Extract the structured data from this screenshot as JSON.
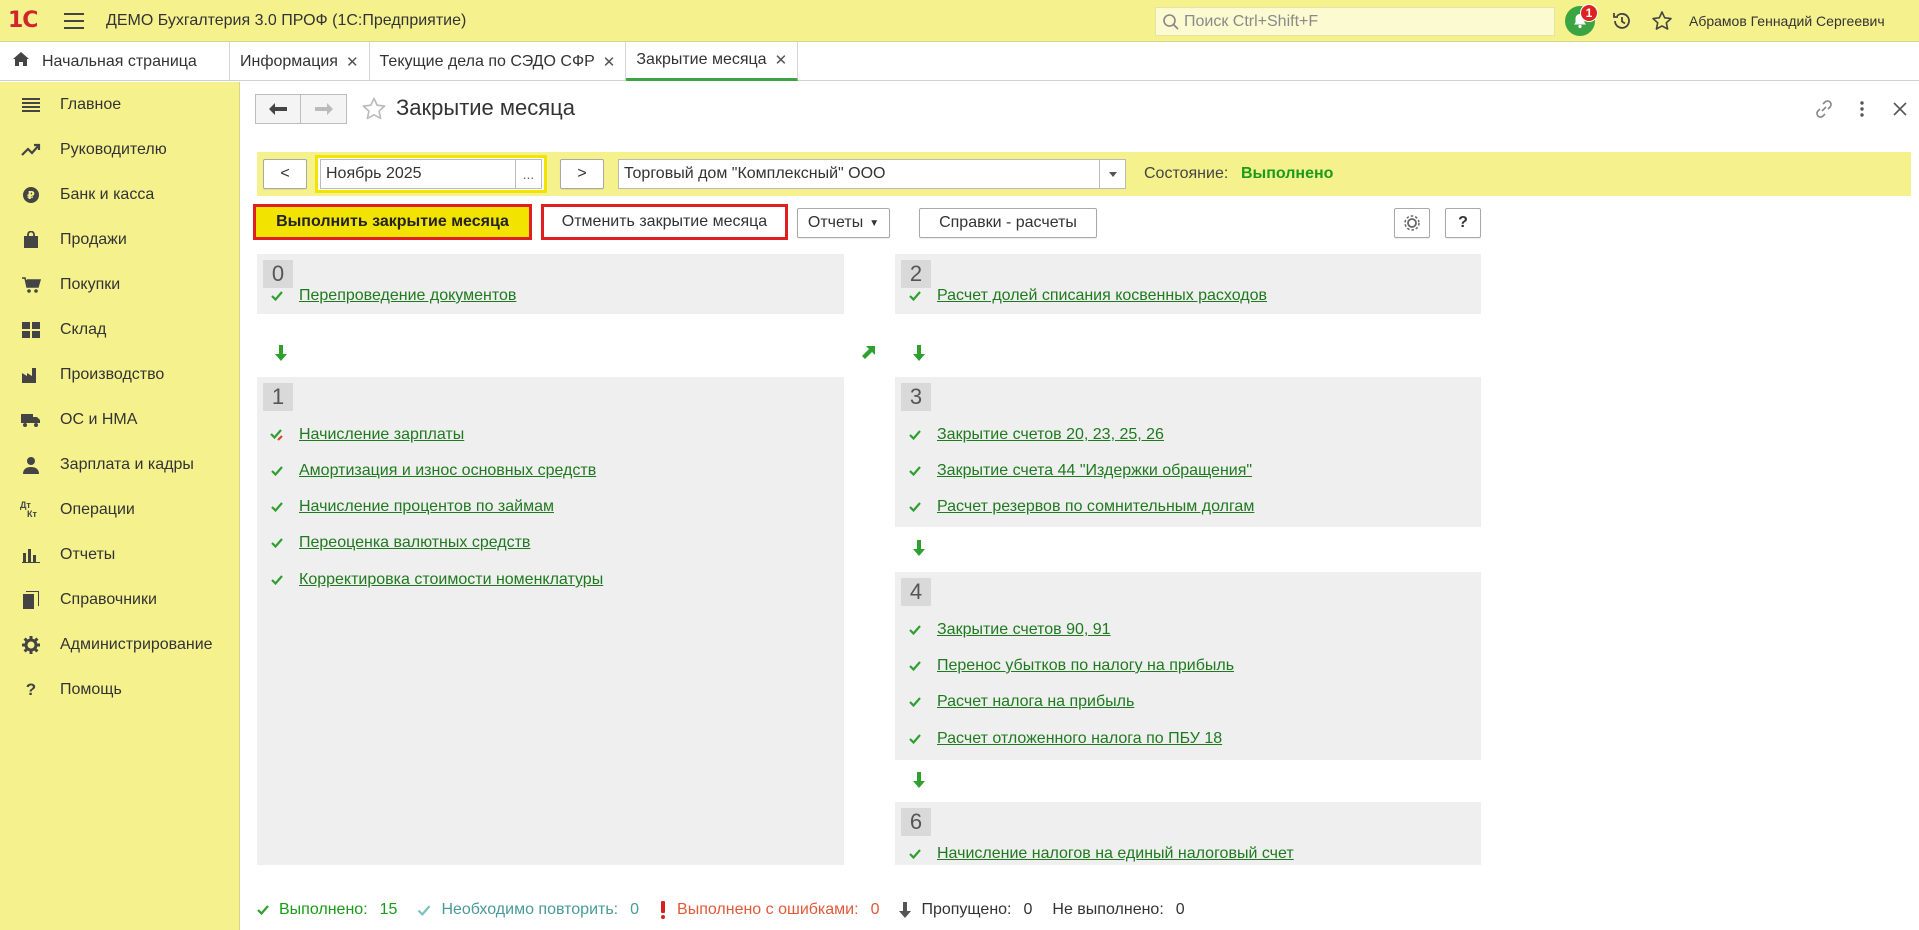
{
  "app": {
    "logo_text": "1С",
    "title": "ДЕМО Бухгалтерия 3.0 ПРОФ  (1С:Предприятие)",
    "search_placeholder": "Поиск Ctrl+Shift+F",
    "notifications_count": "1",
    "user_name": "Абрамов Геннадий Сергеевич",
    "accent_color": "#f5f28e",
    "green": "#1a9b1a"
  },
  "tabs": [
    {
      "label": "Начальная страница",
      "icon": "home-icon"
    },
    {
      "label": "Информация",
      "closable": true
    },
    {
      "label": "Текущие дела по СЭДО СФР",
      "closable": true
    },
    {
      "label": "Закрытие месяца",
      "closable": true,
      "active": true
    }
  ],
  "sidebar": {
    "items": [
      {
        "label": "Главное",
        "icon": "menu-lines-icon"
      },
      {
        "label": "Руководителю",
        "icon": "trend-icon"
      },
      {
        "label": "Банк и касса",
        "icon": "ruble-coin-icon"
      },
      {
        "label": "Продажи",
        "icon": "shopping-bag-icon"
      },
      {
        "label": "Покупки",
        "icon": "cart-icon"
      },
      {
        "label": "Склад",
        "icon": "warehouse-icon"
      },
      {
        "label": "Производство",
        "icon": "factory-icon"
      },
      {
        "label": "ОС и НМА",
        "icon": "truck-icon"
      },
      {
        "label": "Зарплата и кадры",
        "icon": "person-icon"
      },
      {
        "label": "Операции",
        "icon": "dt-kt-icon"
      },
      {
        "label": "Отчеты",
        "icon": "bar-chart-icon"
      },
      {
        "label": "Справочники",
        "icon": "books-icon"
      },
      {
        "label": "Администрирование",
        "icon": "gear-icon"
      },
      {
        "label": "Помощь",
        "icon": "question-icon"
      }
    ],
    "dt_kt": [
      "Дт",
      "Кт"
    ]
  },
  "form": {
    "title": "Закрытие месяца",
    "prev_label": "<",
    "next_label": ">",
    "period_value": "Ноябрь 2025",
    "period_dots": "...",
    "organization": "Торговый дом \"Комплексный\" ООО",
    "state_label": "Состояние:",
    "state_value": "Выполнено",
    "run_button": "Выполнить закрытие месяца",
    "cancel_button": "Отменить закрытие месяца",
    "reports_button": "Отчеты",
    "spravki_button": "Справки - расчеты",
    "help_button": "?"
  },
  "steps": {
    "s0": {
      "num": "0",
      "tasks": [
        "Перепроведение документов"
      ]
    },
    "s1": {
      "num": "1",
      "tasks": [
        "Начисление зарплаты",
        "Амортизация и износ основных средств",
        "Начисление процентов по займам",
        "Переоценка валютных средств",
        "Корректировка стоимости номенклатуры"
      ]
    },
    "s2": {
      "num": "2",
      "tasks": [
        "Расчет долей списания косвенных расходов"
      ]
    },
    "s3": {
      "num": "3",
      "tasks": [
        "Закрытие счетов 20, 23, 25, 26",
        "Закрытие счета 44 \"Издержки обращения\"",
        "Расчет резервов по сомнительным долгам"
      ]
    },
    "s4": {
      "num": "4",
      "tasks": [
        "Закрытие счетов 90, 91",
        "Перенос убытков по налогу на прибыль",
        "Расчет налога на прибыль",
        "Расчет отложенного налога по ПБУ 18"
      ]
    },
    "s6": {
      "num": "6",
      "tasks": [
        "Начисление налогов на единый налоговый счет"
      ]
    }
  },
  "footer": {
    "done_label": "Выполнено:",
    "done_count": "15",
    "done_color": "#1a9b1a",
    "repeat_label": "Необходимо повторить:",
    "repeat_count": "0",
    "repeat_color": "#4a9a9a",
    "errors_label": "Выполнено с ошибками:",
    "errors_count": "0",
    "errors_color": "#e05a3a",
    "skipped_label": "Пропущено:",
    "skipped_count": "0",
    "notdone_label": "Не выполнено:",
    "notdone_count": "0"
  }
}
